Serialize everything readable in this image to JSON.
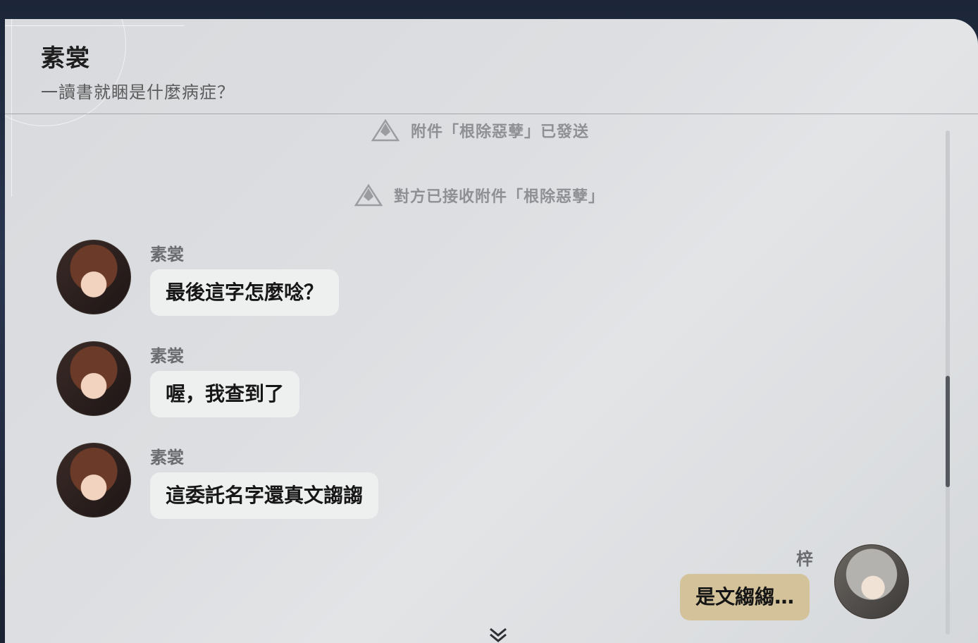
{
  "header": {
    "title": "素裳",
    "subtitle": "一讀書就睏是什麼病症？"
  },
  "system_messages": [
    "附件「根除惡孽」已發送",
    "對方已接收附件「根除惡孽」"
  ],
  "messages": [
    {
      "sender": "素裳",
      "text": "最後這字怎麼唸？"
    },
    {
      "sender": "素裳",
      "text": "喔，我查到了"
    },
    {
      "sender": "素裳",
      "text": "這委託名字還真文謅謅"
    },
    {
      "sender": "梓",
      "text": "是文縐縐…"
    }
  ],
  "icons": {
    "system": "warning-triangle-icon",
    "more": "chevron-down-icon"
  }
}
